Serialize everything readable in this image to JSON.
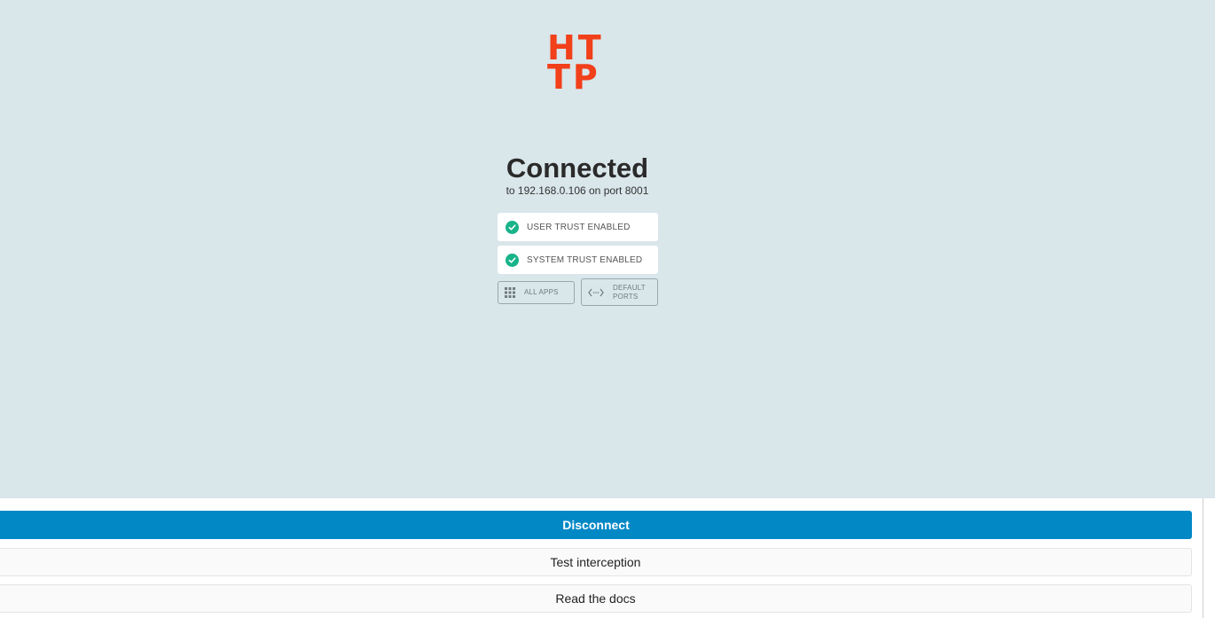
{
  "logo": {
    "line1": "HT",
    "line2": "TP"
  },
  "status": {
    "title": "Connected",
    "subtitle": "to 192.168.0.106 on port 8001"
  },
  "trust": {
    "user": "USER TRUST ENABLED",
    "system": "SYSTEM TRUST ENABLED"
  },
  "options": {
    "all_apps": "ALL APPS",
    "default_ports_line1": "DEFAULT",
    "default_ports_line2": "PORTS"
  },
  "actions": {
    "disconnect": "Disconnect",
    "test_interception": "Test interception",
    "read_docs": "Read the docs"
  },
  "colors": {
    "background": "#d9e6ea",
    "logo": "#f1401a",
    "check": "#18b389",
    "primary": "#0388c6"
  }
}
